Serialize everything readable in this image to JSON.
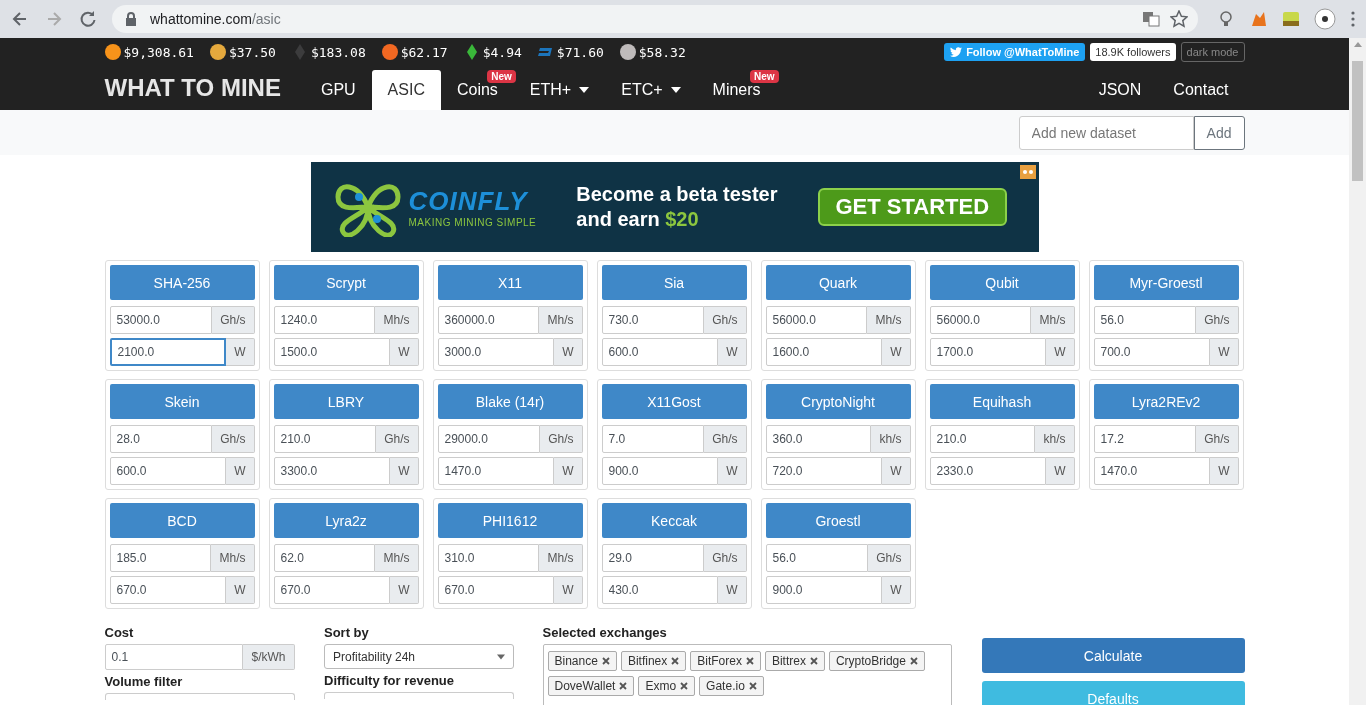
{
  "browser": {
    "url_host": "whattomine.com",
    "url_path": "/asic"
  },
  "ticker": [
    {
      "kind": "circle",
      "color": "#f7931a",
      "price": "$9,308.61"
    },
    {
      "kind": "circle",
      "color": "#e5a93d",
      "price": "$37.50"
    },
    {
      "kind": "diamond",
      "color": "#3c3c3d",
      "price": "$183.08"
    },
    {
      "kind": "circle",
      "color": "#f26822",
      "price": "$62.17"
    },
    {
      "kind": "diamond",
      "color": "#3ab83a",
      "price": "$4.94"
    },
    {
      "kind": "dash",
      "color": "#1c75bc",
      "price": "$71.60"
    },
    {
      "kind": "circle",
      "color": "#bfbbbb",
      "price": "$58.32"
    }
  ],
  "social": {
    "follow": "Follow @WhatToMine",
    "followers": "18.9K followers",
    "dark_mode": "dark mode"
  },
  "brand": "WHAT TO MINE",
  "nav": [
    {
      "label": "GPU",
      "selected": false,
      "dropdown": false
    },
    {
      "label": "ASIC",
      "selected": true,
      "dropdown": false
    },
    {
      "label": "Coins",
      "selected": false,
      "dropdown": false,
      "badge": "New"
    },
    {
      "label": "ETH+",
      "selected": false,
      "dropdown": true
    },
    {
      "label": "ETC+",
      "selected": false,
      "dropdown": true
    },
    {
      "label": "Miners",
      "selected": false,
      "dropdown": false,
      "badge": "New"
    }
  ],
  "nav_right": [
    "JSON",
    "Contact"
  ],
  "dataset": {
    "placeholder": "Add new dataset",
    "button": "Add"
  },
  "ad": {
    "logo": "COINFLY",
    "tagline": "MAKING MINING SIMPLE",
    "line1": "Become a beta tester",
    "line2": "and earn",
    "amount": "$20",
    "cta": "GET STARTED"
  },
  "algorithms": [
    {
      "name": "SHA-256",
      "hashrate": "53000.0",
      "unit": "Gh/s",
      "power": "2100.0",
      "power_unit": "W",
      "focused": true
    },
    {
      "name": "Scrypt",
      "hashrate": "1240.0",
      "unit": "Mh/s",
      "power": "1500.0",
      "power_unit": "W",
      "focused": false
    },
    {
      "name": "X11",
      "hashrate": "360000.0",
      "unit": "Mh/s",
      "power": "3000.0",
      "power_unit": "W",
      "focused": false
    },
    {
      "name": "Sia",
      "hashrate": "730.0",
      "unit": "Gh/s",
      "power": "600.0",
      "power_unit": "W",
      "focused": false
    },
    {
      "name": "Quark",
      "hashrate": "56000.0",
      "unit": "Mh/s",
      "power": "1600.0",
      "power_unit": "W",
      "focused": false
    },
    {
      "name": "Qubit",
      "hashrate": "56000.0",
      "unit": "Mh/s",
      "power": "1700.0",
      "power_unit": "W",
      "focused": false
    },
    {
      "name": "Myr-Groestl",
      "hashrate": "56.0",
      "unit": "Gh/s",
      "power": "700.0",
      "power_unit": "W",
      "focused": false
    },
    {
      "name": "Skein",
      "hashrate": "28.0",
      "unit": "Gh/s",
      "power": "600.0",
      "power_unit": "W",
      "focused": false
    },
    {
      "name": "LBRY",
      "hashrate": "210.0",
      "unit": "Gh/s",
      "power": "3300.0",
      "power_unit": "W",
      "focused": false
    },
    {
      "name": "Blake (14r)",
      "hashrate": "29000.0",
      "unit": "Gh/s",
      "power": "1470.0",
      "power_unit": "W",
      "focused": false
    },
    {
      "name": "X11Gost",
      "hashrate": "7.0",
      "unit": "Gh/s",
      "power": "900.0",
      "power_unit": "W",
      "focused": false
    },
    {
      "name": "CryptoNight",
      "hashrate": "360.0",
      "unit": "kh/s",
      "power": "720.0",
      "power_unit": "W",
      "focused": false
    },
    {
      "name": "Equihash",
      "hashrate": "210.0",
      "unit": "kh/s",
      "power": "2330.0",
      "power_unit": "W",
      "focused": false
    },
    {
      "name": "Lyra2REv2",
      "hashrate": "17.2",
      "unit": "Gh/s",
      "power": "1470.0",
      "power_unit": "W",
      "focused": false
    },
    {
      "name": "BCD",
      "hashrate": "185.0",
      "unit": "Mh/s",
      "power": "670.0",
      "power_unit": "W",
      "focused": false
    },
    {
      "name": "Lyra2z",
      "hashrate": "62.0",
      "unit": "Mh/s",
      "power": "670.0",
      "power_unit": "W",
      "focused": false
    },
    {
      "name": "PHI1612",
      "hashrate": "310.0",
      "unit": "Mh/s",
      "power": "670.0",
      "power_unit": "W",
      "focused": false
    },
    {
      "name": "Keccak",
      "hashrate": "29.0",
      "unit": "Gh/s",
      "power": "430.0",
      "power_unit": "W",
      "focused": false
    },
    {
      "name": "Groestl",
      "hashrate": "56.0",
      "unit": "Gh/s",
      "power": "900.0",
      "power_unit": "W",
      "focused": false
    }
  ],
  "form": {
    "cost": {
      "label": "Cost",
      "value": "0.1",
      "unit": "$/kWh"
    },
    "volume_filter": {
      "label": "Volume filter"
    },
    "sort_by": {
      "label": "Sort by",
      "value": "Profitability 24h"
    },
    "difficulty": {
      "label": "Difficulty for revenue"
    },
    "exchanges": {
      "label": "Selected exchanges",
      "items": [
        "Binance",
        "Bitfinex",
        "BitForex",
        "Bittrex",
        "CryptoBridge",
        "DoveWallet",
        "Exmo",
        "Gate.io"
      ]
    },
    "calculate": "Calculate",
    "defaults": "Defaults"
  }
}
